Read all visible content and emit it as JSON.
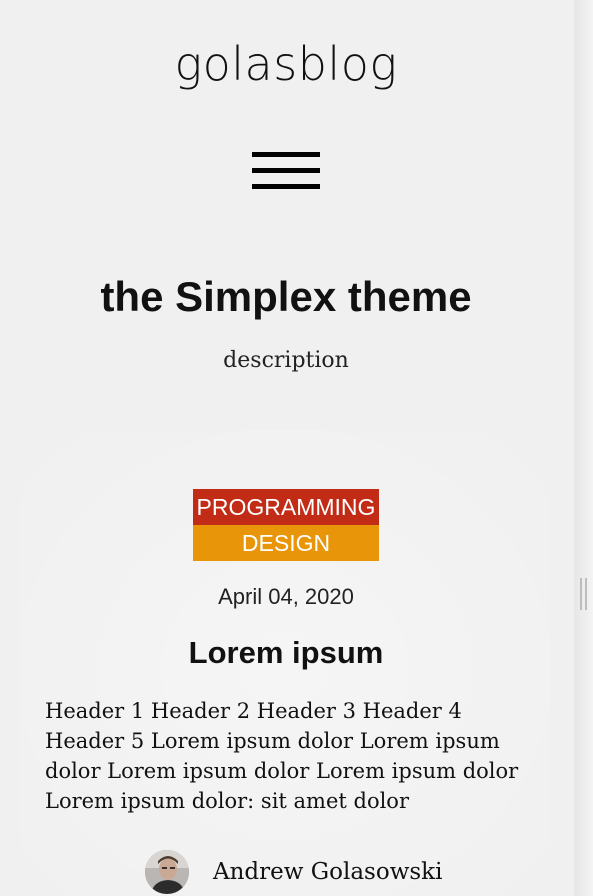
{
  "site": {
    "title": "golasblog"
  },
  "navigation": {
    "menu_icon": "hamburger-menu-icon"
  },
  "hero": {
    "title": "the Simplex theme",
    "description": "description"
  },
  "post": {
    "tags": [
      "PROGRAMMING",
      "DESIGN"
    ],
    "tag_colors": {
      "programming": "#c22b16",
      "design": "#e8950a"
    },
    "date": "April 04, 2020",
    "title": "Lorem ipsum",
    "excerpt": "Header 1 Header 2 Header 3 Header 4 Header 5 Lorem ipsum dolor Lorem ipsum dolor Lorem ipsum dolor Lorem ipsum dolor Lorem ipsum dolor: sit amet dolor",
    "author": {
      "name": "Andrew Golasowski",
      "avatar_icon": "author-avatar-photo"
    }
  },
  "colors": {
    "background": "#f0f0f0",
    "text": "#111111"
  }
}
